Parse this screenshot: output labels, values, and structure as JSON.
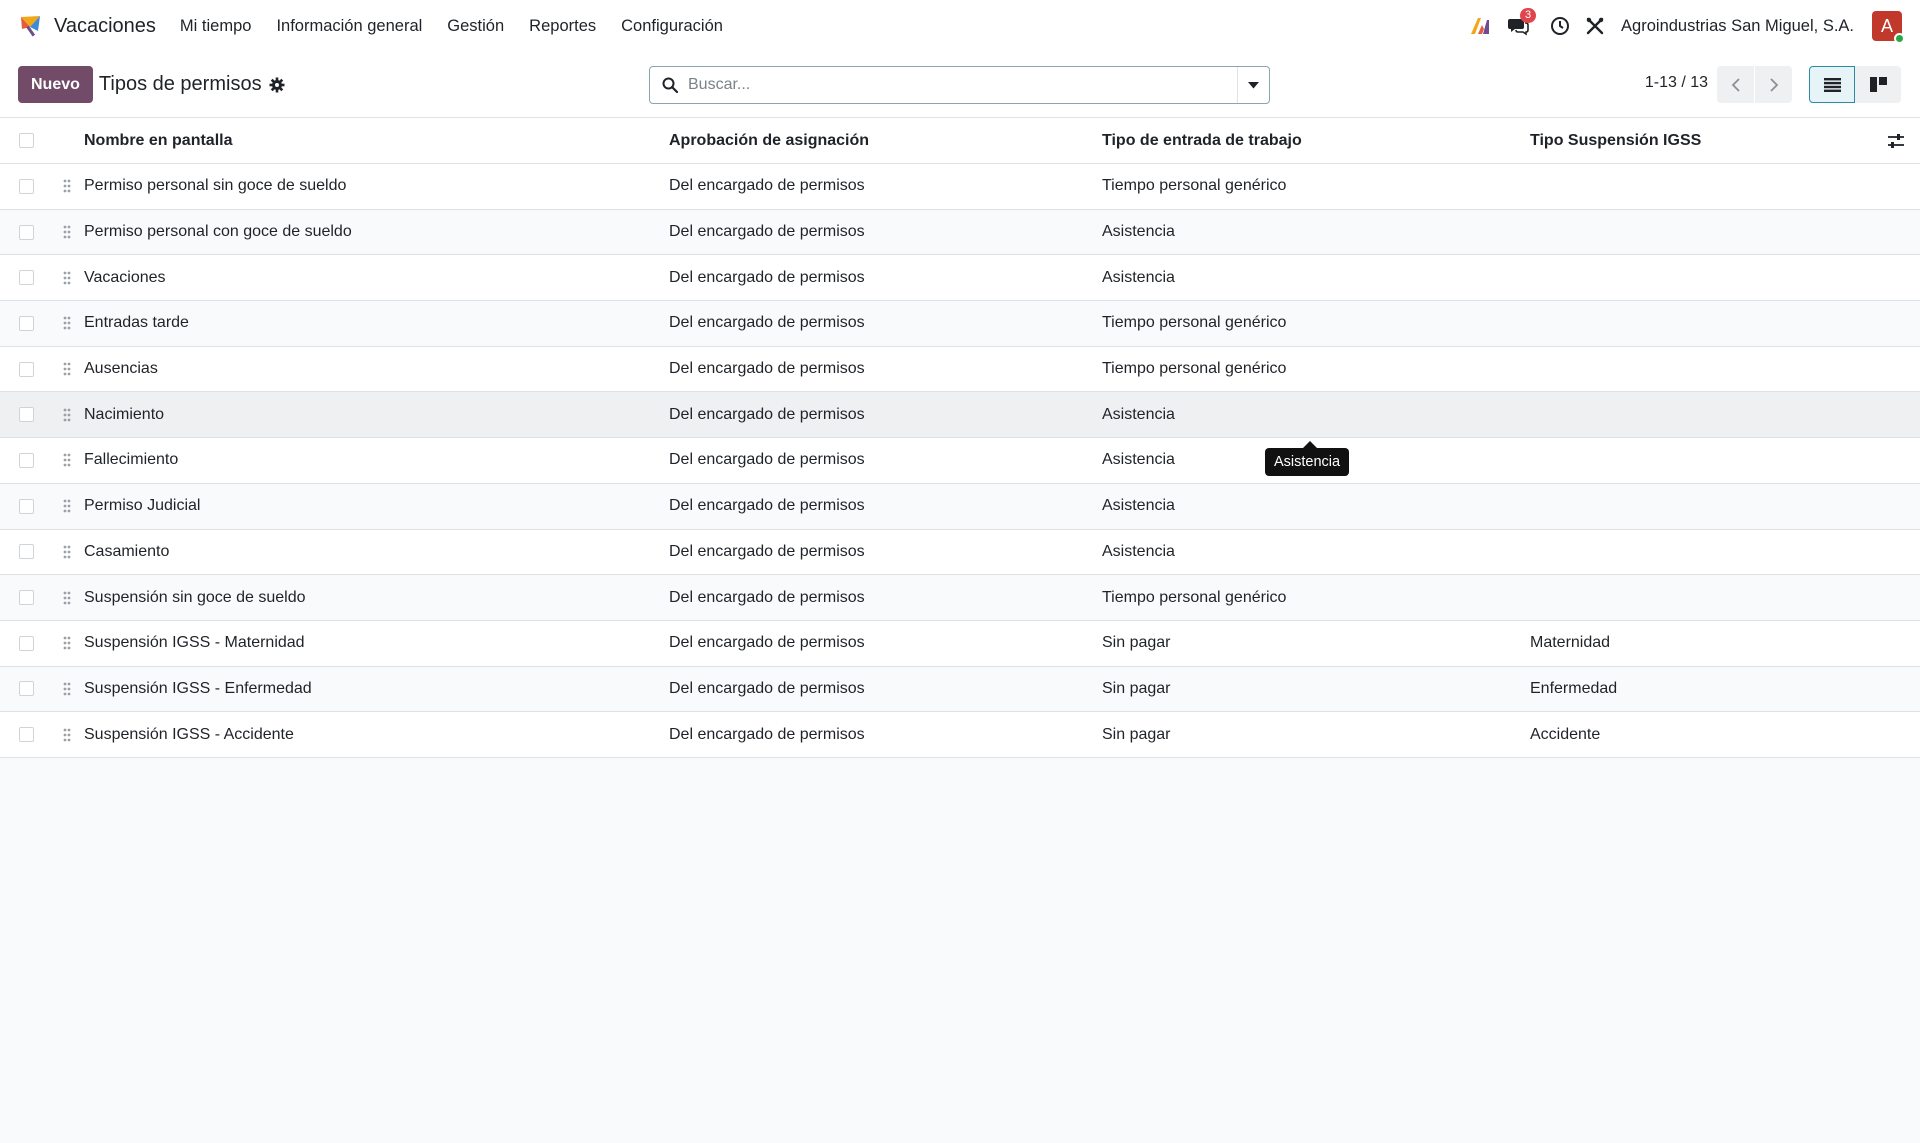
{
  "nav": {
    "app_name": "Vacaciones",
    "menu": [
      "Mi tiempo",
      "Información general",
      "Gestión",
      "Reportes",
      "Configuración"
    ],
    "message_count": "3",
    "company": "Agroindustrias San Miguel, S.A.",
    "avatar_letter": "A"
  },
  "control": {
    "new_label": "Nuevo",
    "title": "Tipos de permisos",
    "search_placeholder": "Buscar...",
    "pager": "1-13 / 13"
  },
  "table": {
    "headers": [
      "Nombre en pantalla",
      "Aprobación de asignación",
      "Tipo de entrada de trabajo",
      "Tipo Suspensión IGSS"
    ],
    "rows": [
      {
        "name": "Permiso personal sin goce de sueldo",
        "approval": "Del encargado de permisos",
        "work_entry": "Tiempo personal genérico",
        "igss": ""
      },
      {
        "name": "Permiso personal con goce de sueldo",
        "approval": "Del encargado de permisos",
        "work_entry": "Asistencia",
        "igss": ""
      },
      {
        "name": "Vacaciones",
        "approval": "Del encargado de permisos",
        "work_entry": "Asistencia",
        "igss": ""
      },
      {
        "name": "Entradas tarde",
        "approval": "Del encargado de permisos",
        "work_entry": "Tiempo personal genérico",
        "igss": ""
      },
      {
        "name": "Ausencias",
        "approval": "Del encargado de permisos",
        "work_entry": "Tiempo personal genérico",
        "igss": ""
      },
      {
        "name": "Nacimiento",
        "approval": "Del encargado de permisos",
        "work_entry": "Asistencia",
        "igss": ""
      },
      {
        "name": "Fallecimiento",
        "approval": "Del encargado de permisos",
        "work_entry": "Asistencia",
        "igss": ""
      },
      {
        "name": "Permiso Judicial",
        "approval": "Del encargado de permisos",
        "work_entry": "Asistencia",
        "igss": ""
      },
      {
        "name": "Casamiento",
        "approval": "Del encargado de permisos",
        "work_entry": "Asistencia",
        "igss": ""
      },
      {
        "name": "Suspensión sin goce de sueldo",
        "approval": "Del encargado de permisos",
        "work_entry": "Tiempo personal genérico",
        "igss": ""
      },
      {
        "name": "Suspensión IGSS - Maternidad",
        "approval": "Del encargado de permisos",
        "work_entry": "Sin pagar",
        "igss": "Maternidad"
      },
      {
        "name": "Suspensión IGSS - Enfermedad",
        "approval": "Del encargado de permisos",
        "work_entry": "Sin pagar",
        "igss": "Enfermedad"
      },
      {
        "name": "Suspensión IGSS - Accidente",
        "approval": "Del encargado de permisos",
        "work_entry": "Sin pagar",
        "igss": "Accidente"
      }
    ]
  },
  "tooltip": "Asistencia",
  "colors": {
    "primary": "#714b67",
    "accent": "#2a8ca3",
    "badge": "#e0454d",
    "avatar": "#c0392b"
  }
}
